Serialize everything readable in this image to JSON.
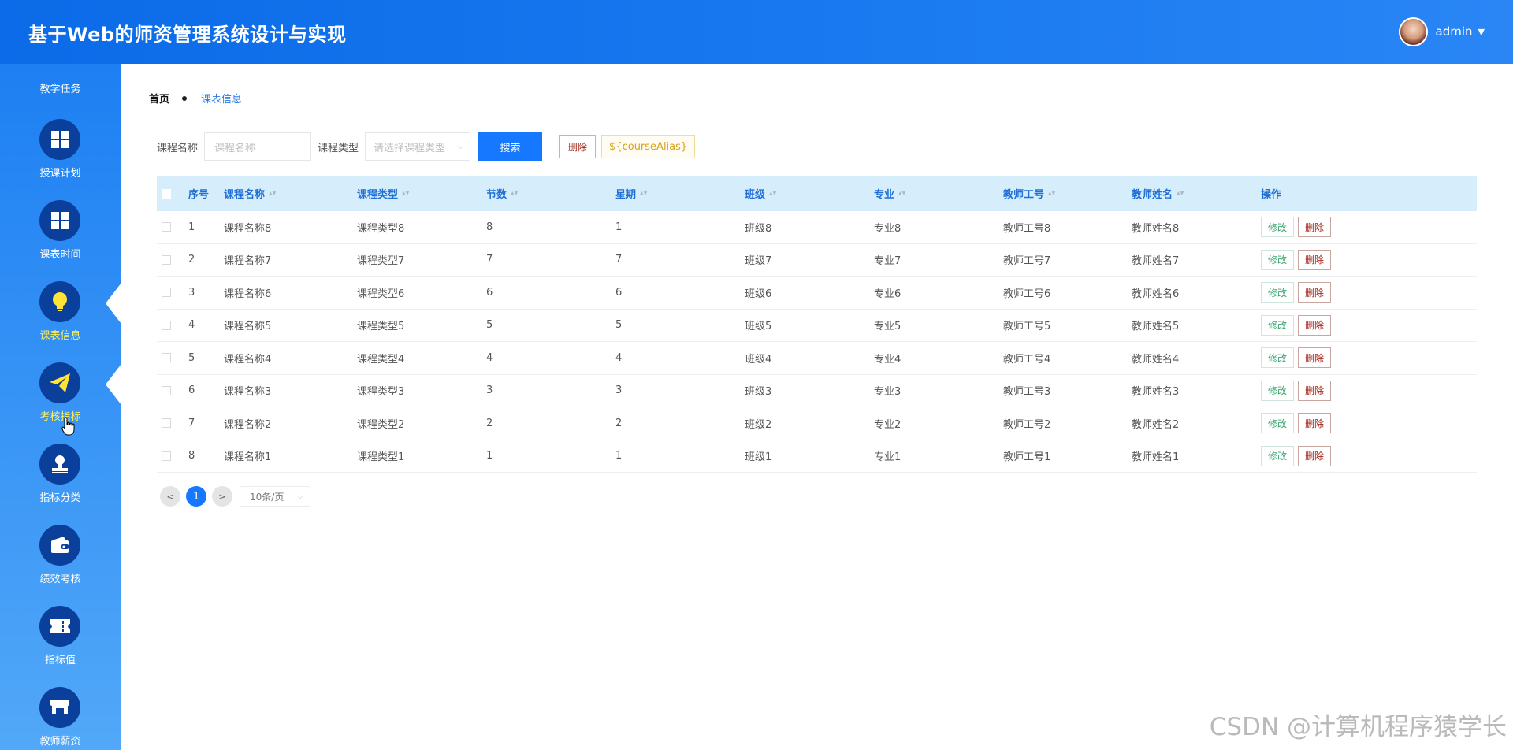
{
  "header": {
    "title": "基于Web的师资管理系统设计与实现",
    "username": "admin"
  },
  "sidebar": {
    "top_label": "教学任务",
    "items": [
      {
        "label": "授课计划",
        "icon": "grid-icon"
      },
      {
        "label": "课表时间",
        "icon": "grid-icon"
      },
      {
        "label": "课表信息",
        "icon": "lightbulb-icon"
      },
      {
        "label": "考核指标",
        "icon": "paper-plane-icon"
      },
      {
        "label": "指标分类",
        "icon": "stamp-icon"
      },
      {
        "label": "绩效考核",
        "icon": "wallet-icon"
      },
      {
        "label": "指标值",
        "icon": "ticket-icon"
      },
      {
        "label": "教师薪资",
        "icon": "shop-icon"
      }
    ]
  },
  "breadcrumb": {
    "home": "首页",
    "current": "课表信息"
  },
  "filters": {
    "course_name_label": "课程名称",
    "course_name_placeholder": "课程名称",
    "course_type_label": "课程类型",
    "course_type_placeholder": "请选择课程类型",
    "search_label": "搜索",
    "delete_label": "删除",
    "alias_label": "${courseAlias}"
  },
  "table": {
    "headers": {
      "no": "序号",
      "name": "课程名称",
      "type": "课程类型",
      "section": "节数",
      "week": "星期",
      "class": "班级",
      "major": "专业",
      "teacher_no": "教师工号",
      "teacher_name": "教师姓名",
      "ops": "操作"
    },
    "edit_label": "修改",
    "delete_label": "删除",
    "rows": [
      {
        "no": "1",
        "name": "课程名称8",
        "type": "课程类型8",
        "section": "8",
        "week": "1",
        "class": "班级8",
        "major": "专业8",
        "teacher_no": "教师工号8",
        "teacher_name": "教师姓名8"
      },
      {
        "no": "2",
        "name": "课程名称7",
        "type": "课程类型7",
        "section": "7",
        "week": "7",
        "class": "班级7",
        "major": "专业7",
        "teacher_no": "教师工号7",
        "teacher_name": "教师姓名7"
      },
      {
        "no": "3",
        "name": "课程名称6",
        "type": "课程类型6",
        "section": "6",
        "week": "6",
        "class": "班级6",
        "major": "专业6",
        "teacher_no": "教师工号6",
        "teacher_name": "教师姓名6"
      },
      {
        "no": "4",
        "name": "课程名称5",
        "type": "课程类型5",
        "section": "5",
        "week": "5",
        "class": "班级5",
        "major": "专业5",
        "teacher_no": "教师工号5",
        "teacher_name": "教师姓名5"
      },
      {
        "no": "5",
        "name": "课程名称4",
        "type": "课程类型4",
        "section": "4",
        "week": "4",
        "class": "班级4",
        "major": "专业4",
        "teacher_no": "教师工号4",
        "teacher_name": "教师姓名4"
      },
      {
        "no": "6",
        "name": "课程名称3",
        "type": "课程类型3",
        "section": "3",
        "week": "3",
        "class": "班级3",
        "major": "专业3",
        "teacher_no": "教师工号3",
        "teacher_name": "教师姓名3"
      },
      {
        "no": "7",
        "name": "课程名称2",
        "type": "课程类型2",
        "section": "2",
        "week": "2",
        "class": "班级2",
        "major": "专业2",
        "teacher_no": "教师工号2",
        "teacher_name": "教师姓名2"
      },
      {
        "no": "8",
        "name": "课程名称1",
        "type": "课程类型1",
        "section": "1",
        "week": "1",
        "class": "班级1",
        "major": "专业1",
        "teacher_no": "教师工号1",
        "teacher_name": "教师姓名1"
      }
    ]
  },
  "pagination": {
    "prev": "<",
    "current_page": "1",
    "next": ">",
    "page_size": "10条/页"
  },
  "watermark": "CSDN @计算机程序猿学长",
  "colors": {
    "primary": "#1677ff",
    "header_bg": "#0b6be8",
    "sidebar_icon_bg": "#0b3f9c",
    "active_label": "#ffee58",
    "table_header_bg": "#d6eefc"
  }
}
